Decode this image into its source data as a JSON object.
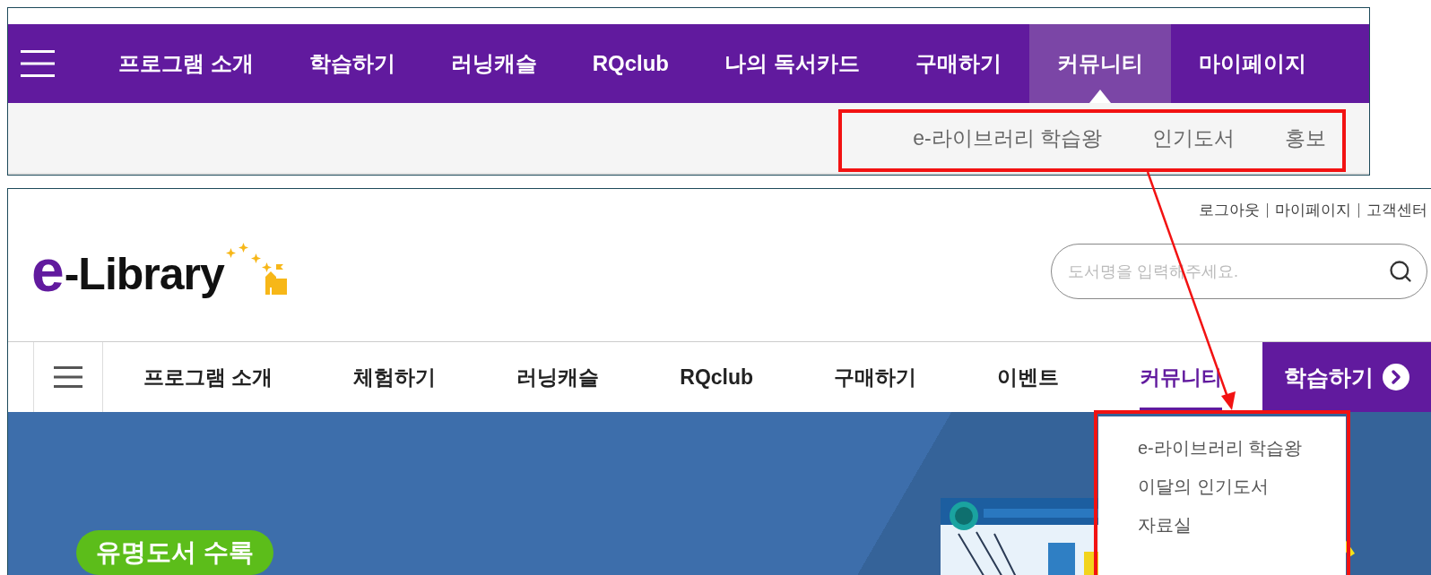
{
  "top_screen": {
    "menu": [
      {
        "label": "프로그램 소개",
        "selected": false
      },
      {
        "label": "학습하기",
        "selected": false
      },
      {
        "label": "러닝캐슬",
        "selected": false
      },
      {
        "label": "RQclub",
        "selected": false
      },
      {
        "label": "나의 독서카드",
        "selected": false
      },
      {
        "label": "구매하기",
        "selected": false
      },
      {
        "label": "커뮤니티",
        "selected": true
      },
      {
        "label": "마이페이지",
        "selected": false
      }
    ],
    "submenu": [
      "e-라이브러리 학습왕",
      "인기도서",
      "홍보"
    ]
  },
  "bottom_screen": {
    "logo": {
      "mark": "e",
      "text": "-Library"
    },
    "utility_links": [
      "로그아웃",
      "마이페이지",
      "고객센터"
    ],
    "search": {
      "placeholder": "도서명을 입력해주세요."
    },
    "menu": [
      {
        "label": "프로그램 소개",
        "selected": false
      },
      {
        "label": "체험하기",
        "selected": false
      },
      {
        "label": "러닝캐슬",
        "selected": false
      },
      {
        "label": "RQclub",
        "selected": false
      },
      {
        "label": "구매하기",
        "selected": false
      },
      {
        "label": "이벤트",
        "selected": false
      },
      {
        "label": "커뮤니티",
        "selected": true
      }
    ],
    "cta_button": "학습하기",
    "dropdown": [
      "e-라이브러리 학습왕",
      "이달의 인기도서",
      "자료실"
    ],
    "banner": {
      "badge": "유명도서 수록"
    }
  }
}
